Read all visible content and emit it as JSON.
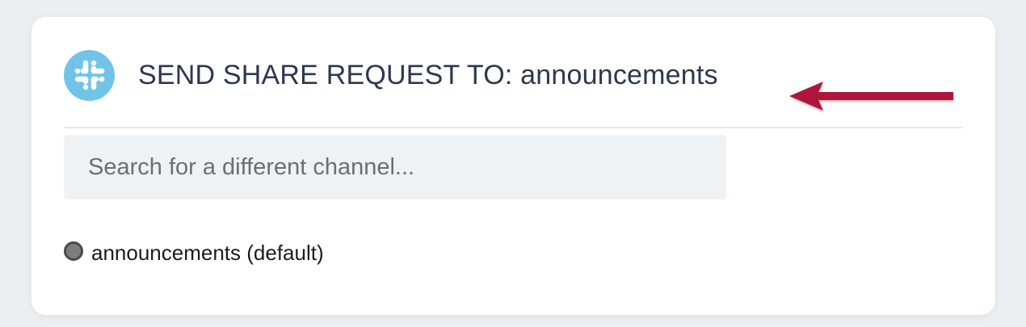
{
  "header": {
    "title": "SEND SHARE REQUEST TO: announcements",
    "logo_icon": "slack-icon",
    "logo_color": "#71c4e8"
  },
  "annotation": {
    "arrow_icon": "left-arrow-icon",
    "arrow_color": "#b0183b"
  },
  "search": {
    "placeholder": "Search for a different channel...",
    "value": ""
  },
  "channels": [
    {
      "label": "announcements (default)",
      "selected": true
    }
  ]
}
